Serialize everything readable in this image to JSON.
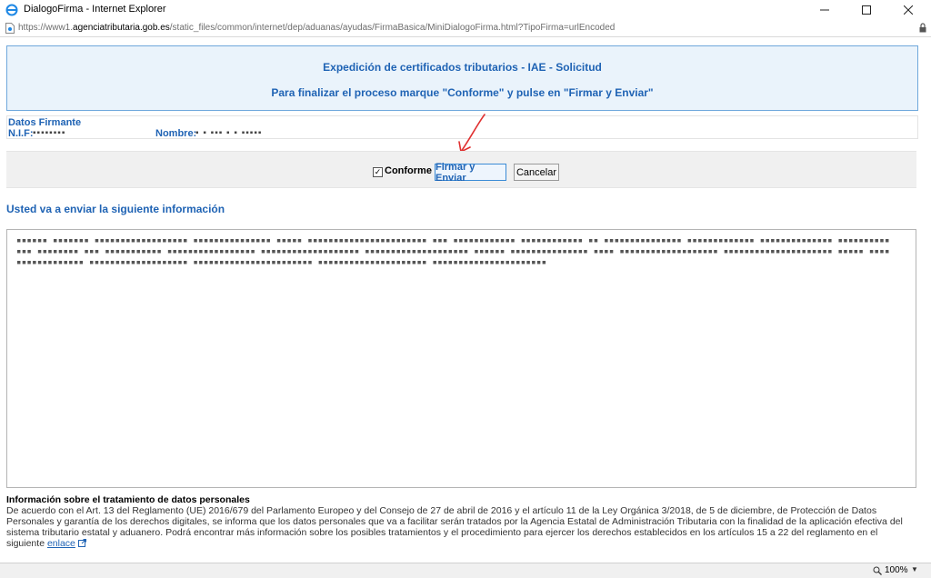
{
  "window": {
    "title": "DialogoFirma - Internet Explorer",
    "minimize_icon": "minimize-icon",
    "maximize_icon": "maximize-icon",
    "close_icon": "close-icon"
  },
  "address": {
    "prefix": "https://www1.",
    "domain": "agenciatributaria.gob.es",
    "path": "/static_files/common/internet/dep/aduanas/ayudas/FirmaBasica/MiniDialogoFirma.html?TipoFirma=urlEncoded"
  },
  "header": {
    "title": "Expedición de certificados tributarios - IAE - Solicitud",
    "subtitle": "Para finalizar el proceso marque \"Conforme\" y pulse en \"Firmar y Enviar\""
  },
  "firmante": {
    "section_title": "Datos Firmante",
    "nif_label": "N.I.F:",
    "nif_value": "▪▪▪▪▪▪▪▪",
    "nombre_label": "Nombre:",
    "nombre_value": "▪ ▪ ▪▪▪ ▪ ▪ ▪▪▪▪▪"
  },
  "actions": {
    "conforme_label": "Conforme",
    "conforme_checked": true,
    "firmar_label": "Firmar y Enviar",
    "cancel_label": "Cancelar"
  },
  "info": {
    "heading": "Usted va a enviar la siguiente información",
    "encoded_text": "▪▪▪▪▪▪ ▪▪▪▪▪▪▪ ▪▪▪▪▪▪▪▪▪▪▪▪▪▪▪▪▪▪ ▪▪▪▪▪▪▪▪▪▪▪▪▪▪▪ ▪▪▪▪▪ ▪▪▪▪▪▪▪▪▪▪▪▪▪▪▪▪▪▪▪▪▪▪▪ ▪▪▪ ▪▪▪▪▪▪▪▪▪▪▪▪ ▪▪▪▪▪▪▪▪▪▪▪▪ ▪▪ ▪▪▪▪▪▪▪▪▪▪▪▪▪▪▪ ▪▪▪▪▪▪▪▪▪▪▪▪▪ ▪▪▪▪▪▪▪▪▪▪▪▪▪▪ ▪▪▪▪▪▪▪▪▪▪▪▪▪ ▪▪▪▪▪▪▪▪ ▪▪▪ ▪▪▪▪▪▪▪▪▪▪▪ ▪▪▪▪▪▪▪▪▪▪▪▪▪▪▪▪▪ ▪▪▪▪▪▪▪▪▪▪▪▪▪▪▪▪▪▪▪ ▪▪▪▪▪▪▪▪▪▪▪▪▪▪▪▪▪▪▪▪ ▪▪▪▪▪▪ ▪▪▪▪▪▪▪▪▪▪▪▪▪▪▪ ▪▪▪▪ ▪▪▪▪▪▪▪▪▪▪▪▪▪▪▪▪▪▪▪ ▪▪▪▪▪▪▪▪▪▪▪▪▪▪▪▪▪▪▪▪▪ ▪▪▪▪▪ ▪▪▪▪▪▪▪▪▪▪▪▪▪▪▪▪▪ ▪▪▪▪▪▪▪▪▪▪▪▪▪▪▪▪▪▪▪ ▪▪▪▪▪▪▪▪▪▪▪▪▪▪▪▪▪▪▪▪▪▪▪ ▪▪▪▪▪▪▪▪▪▪▪▪▪▪▪▪▪▪▪▪▪ ▪▪▪▪▪▪▪▪▪▪▪▪▪▪▪▪▪▪▪▪▪▪"
  },
  "privacy": {
    "title": "Información sobre el tratamiento de datos personales",
    "body": "De acuerdo con el Art. 13 del Reglamento (UE) 2016/679 del Parlamento Europeo y del Consejo de 27 de abril de 2016 y el artículo 11 de la Ley Orgánica 3/2018, de 5 de diciembre, de Protección de Datos Personales y garantía de los derechos digitales, se informa que los datos personales que va a facilitar serán tratados por la Agencia Estatal de Administración Tributaria con la finalidad de la aplicación efectiva del sistema tributario estatal y aduanero. Podrá encontrar más información sobre los posibles tratamientos y el procedimiento para ejercer los derechos establecidos en los artículos 15 a 22 del reglamento en el siguiente",
    "link_label": "enlace"
  },
  "status": {
    "zoom": "100%"
  },
  "colors": {
    "accent": "#1f63b4",
    "header_bg": "#eaf3fb",
    "arrow": "#e03030"
  }
}
